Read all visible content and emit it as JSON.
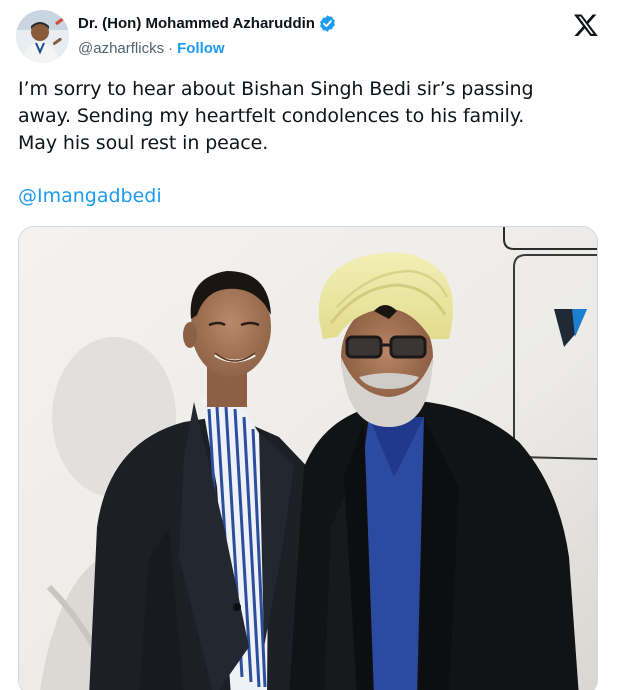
{
  "author": {
    "display_name": "Dr. (Hon) Mohammed Azharuddin",
    "handle": "@azharflicks",
    "separator": "·",
    "follow_label": "Follow",
    "verified": true
  },
  "tweet": {
    "lines": [
      "I’m sorry to hear about Bishan Singh Bedi sir’s passing",
      "away. Sending my heartfelt condolences to his family.",
      "May his soul rest in peace."
    ],
    "mention": "@Imangadbedi"
  },
  "icons": {
    "platform_logo": "x-logo-icon",
    "verified_badge": "verified-badge-icon"
  },
  "colors": {
    "text": "#0f1419",
    "secondary": "#536471",
    "link": "#1d9bf0",
    "border": "#cfd9de"
  }
}
